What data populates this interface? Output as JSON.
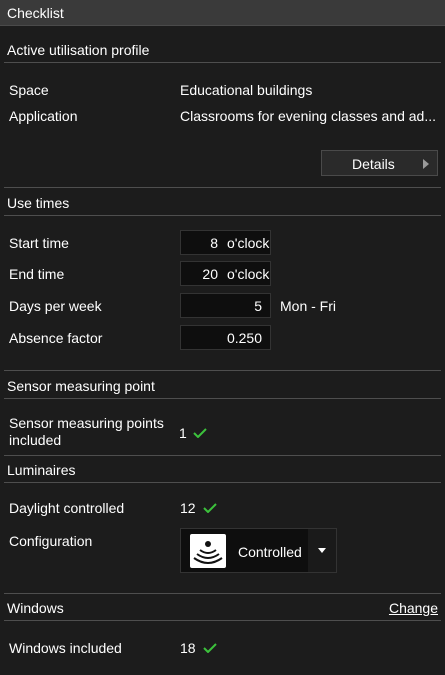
{
  "title": "Checklist",
  "profile": {
    "heading": "Active utilisation profile",
    "space_label": "Space",
    "space_value": "Educational buildings",
    "application_label": "Application",
    "application_value": "Classrooms for evening classes and ad...",
    "details_button": "Details"
  },
  "use_times": {
    "heading": "Use times",
    "start_label": "Start time",
    "start_value": "8",
    "start_unit": "o'clock",
    "end_label": "End time",
    "end_value": "20",
    "end_unit": "o'clock",
    "days_label": "Days per week",
    "days_value": "5",
    "days_suffix": "Mon - Fri",
    "absence_label": "Absence factor",
    "absence_value": "0.250"
  },
  "sensor": {
    "heading": "Sensor measuring point",
    "included_label_line1": "Sensor measuring points",
    "included_label_line2": "included",
    "included_count": "1"
  },
  "luminaires": {
    "heading": "Luminaires",
    "daylight_label": "Daylight controlled",
    "daylight_count": "12",
    "config_label": "Configuration",
    "config_value": "Controlled"
  },
  "windows": {
    "heading": "Windows",
    "change_link": "Change",
    "included_label": "Windows included",
    "included_count": "18"
  },
  "colors": {
    "check": "#3cc23c",
    "background": "#1c1c1c",
    "field_background": "#0e0e0e"
  },
  "icons": {
    "check": "checkmark-icon",
    "details_chevron": "chevron-right-icon",
    "config_sensor": "sensor-waves-icon",
    "config_dropdown": "chevron-down-icon"
  }
}
